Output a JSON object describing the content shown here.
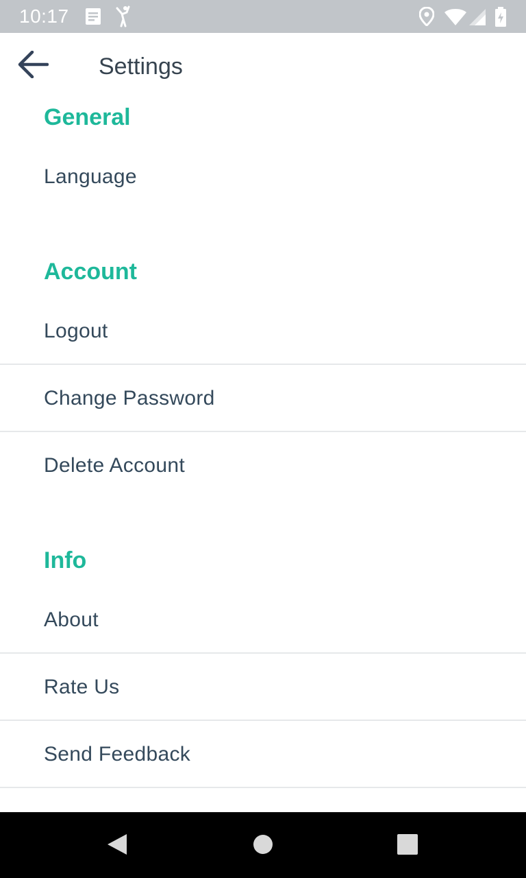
{
  "status_bar": {
    "time": "10:17",
    "icons": [
      "notes-icon",
      "figure-icon",
      "location-icon",
      "wifi-icon",
      "signal-icon",
      "battery-icon"
    ]
  },
  "app_bar": {
    "title": "Settings",
    "back_icon": "arrow-back-icon"
  },
  "sections": {
    "general": {
      "header": "General",
      "items": [
        "Language"
      ]
    },
    "account": {
      "header": "Account",
      "items": [
        "Logout",
        "Change Password",
        "Delete Account"
      ]
    },
    "info": {
      "header": "Info",
      "items": [
        "About",
        "Rate Us",
        "Send Feedback"
      ]
    }
  },
  "nav_bar": {
    "buttons": [
      "back-triangle-icon",
      "home-circle-icon",
      "recents-square-icon"
    ]
  },
  "colors": {
    "accent": "#1eb89a",
    "text": "#34495b",
    "status_bar": "#c1c5c9",
    "nav_bar": "#000000"
  }
}
